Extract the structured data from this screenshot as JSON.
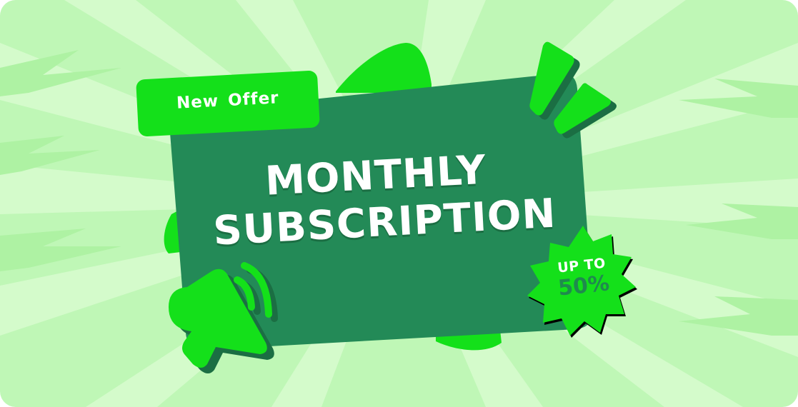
{
  "banner": {
    "tag_label": "New Offer",
    "headline_line1": "MONTHLY",
    "headline_line2": "SUBSCRIPTION",
    "badge_line1": "UP TO",
    "badge_line2": "50%"
  },
  "colors": {
    "background": "#bff7b6",
    "card": "#238a57",
    "accent": "#14e01a",
    "text": "#ffffff"
  },
  "icons": {
    "megaphone": "megaphone-icon",
    "exclamation": "exclamation-marks-icon"
  }
}
